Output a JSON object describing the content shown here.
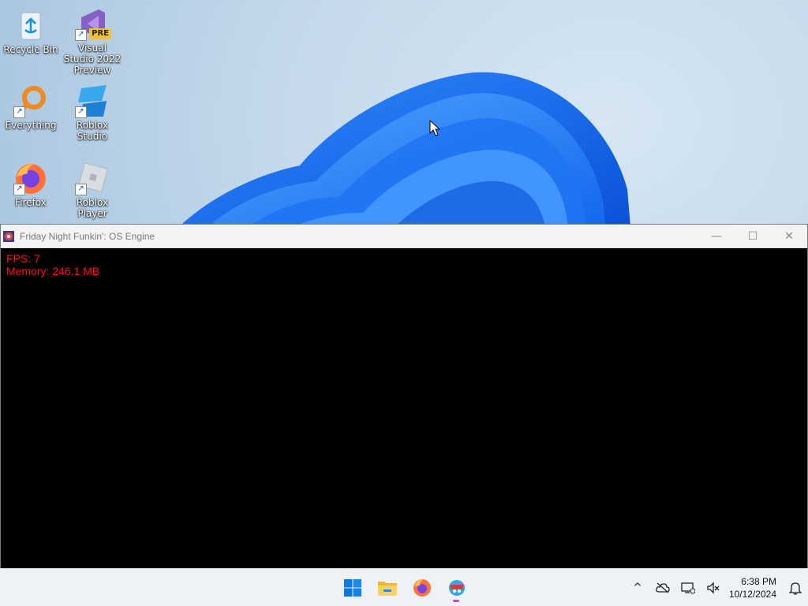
{
  "desktop": {
    "icons": [
      {
        "label": "Recycle Bin"
      },
      {
        "label": "Visual Studio 2022 Preview",
        "badge": "PRE"
      },
      {
        "label": "Everything"
      },
      {
        "label": "Roblox Studio"
      },
      {
        "label": "Firefox"
      },
      {
        "label": "Roblox Player"
      }
    ]
  },
  "window": {
    "title": "Friday Night Funkin': OS Engine",
    "controls": {
      "minimize": "—",
      "maximize": "☐",
      "close": "✕"
    },
    "overlay": {
      "fps": "FPS: 7",
      "memory": "Memory: 246.1 MB"
    }
  },
  "taskbar": {
    "items": [
      "start-icon",
      "file-explorer-icon",
      "firefox-icon",
      "fnf-icon"
    ],
    "tray": {
      "chevron": "^",
      "time": "6:38 PM",
      "date": "10/12/2024"
    }
  }
}
